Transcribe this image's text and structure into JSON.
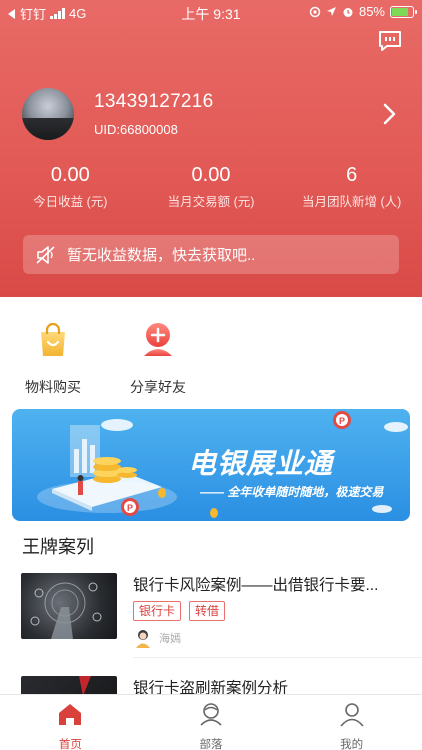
{
  "status_bar": {
    "carrier": "钉钉",
    "network": "4G",
    "time": "上午 9:31",
    "battery_text": "85%",
    "battery_level": 0.85
  },
  "header": {
    "phone": "13439127216",
    "uid": "UID:66800008",
    "stats": [
      {
        "value": "0.00",
        "label": "今日收益 (元)"
      },
      {
        "value": "0.00",
        "label": "当月交易额 (元)"
      },
      {
        "value": "6",
        "label": "当月团队新增 (人)"
      }
    ],
    "notice": "暂无收益数据，快去获取吧.."
  },
  "quick_menu": [
    {
      "label": "物料购买",
      "icon": "shopping-bag-icon"
    },
    {
      "label": "分享好友",
      "icon": "share-friend-icon"
    }
  ],
  "banner": {
    "title": "电银展业通",
    "subtitle": "—— 全年收单随时随地，极速交易"
  },
  "section": {
    "title": "王牌案列"
  },
  "cases": [
    {
      "title": "银行卡风险案例——出借银行卡要...",
      "tags": [
        "银行卡",
        "转借"
      ],
      "author": "海嫣"
    },
    {
      "title": "银行卡盗刷新案例分析",
      "tags": [],
      "author": ""
    }
  ],
  "tabbar": [
    {
      "label": "首页",
      "icon": "home-icon",
      "active": true
    },
    {
      "label": "部落",
      "icon": "tribe-icon",
      "active": false
    },
    {
      "label": "我的",
      "icon": "profile-icon",
      "active": false
    }
  ],
  "colors": {
    "brand_red": "#e25a56",
    "tab_active": "#d9413d",
    "tab_inactive": "#666666"
  }
}
